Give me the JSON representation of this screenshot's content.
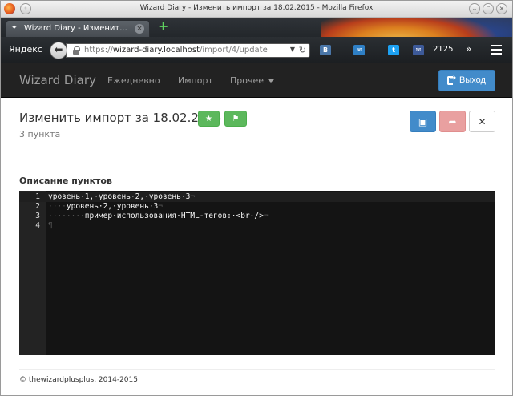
{
  "window": {
    "title": "Wizard Diary - Изменить импорт за 18.02.2015 - Mozilla Firefox"
  },
  "browser": {
    "tab_label": "Wizard Diary - Изменит...",
    "yandex_label": "Яндекс",
    "url_scheme": "https://",
    "url_host": "wizard-diary.localhost",
    "url_path": "/import/4/update",
    "toolbar_count": "2125",
    "icons": [
      "vk-icon",
      "mail-icon",
      "twitter-icon",
      "envelope-icon"
    ]
  },
  "site": {
    "brand": "Wizard Diary",
    "nav": [
      {
        "label": "Ежедневно"
      },
      {
        "label": "Импорт"
      },
      {
        "label": "Прочее"
      }
    ],
    "logout_label": "Выход"
  },
  "page": {
    "title": "Изменить импорт за 18.02.2015",
    "subtitle": "3 пункта",
    "section_label": "Описание пунктов"
  },
  "editor": {
    "lines": [
      {
        "num": "1",
        "indent": "",
        "text": "уровень·1,·уровень·2,·уровень·3",
        "eol": "¬"
      },
      {
        "num": "2",
        "indent": "····",
        "text": "уровень·2,·уровень·3",
        "eol": "¬"
      },
      {
        "num": "3",
        "indent": "········",
        "text": "пример·использования·HTML-тегов:·<br·/>",
        "eol": "¬"
      },
      {
        "num": "4",
        "indent": "",
        "text": "",
        "eol": "¶"
      }
    ]
  },
  "footer": {
    "text": "© thewizardplusplus, 2014-2015"
  },
  "colors": {
    "primary": "#428bca",
    "success": "#5cb85c",
    "danger_light": "#e9a0a0",
    "navbar": "#222222",
    "editor_bg": "#141414"
  }
}
